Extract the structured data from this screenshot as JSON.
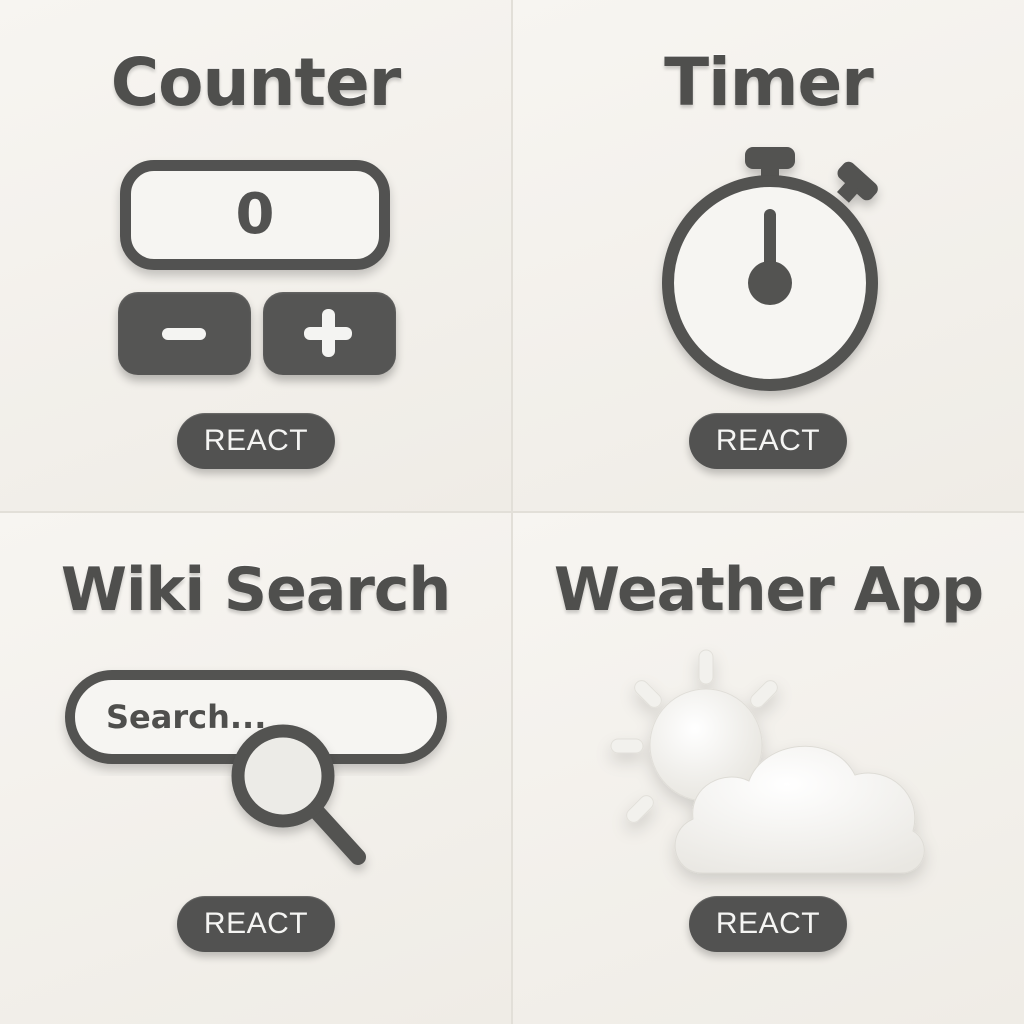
{
  "cards": {
    "counter": {
      "title": "Counter",
      "value": "0",
      "badge": "REACT",
      "icons": [
        "minus-icon",
        "plus-icon"
      ]
    },
    "timer": {
      "title": "Timer",
      "badge": "REACT",
      "icon": "stopwatch-icon"
    },
    "wiki": {
      "title": "Wiki Search",
      "search_placeholder": "Search...",
      "badge": "REACT",
      "icon": "magnifier-icon"
    },
    "weather": {
      "title": "Weather App",
      "badge": "REACT",
      "icon": "sun-cloud-icon"
    }
  },
  "colors": {
    "background": "#f3f1ec",
    "accent_dark": "#525251",
    "light": "#f6f5f2"
  }
}
